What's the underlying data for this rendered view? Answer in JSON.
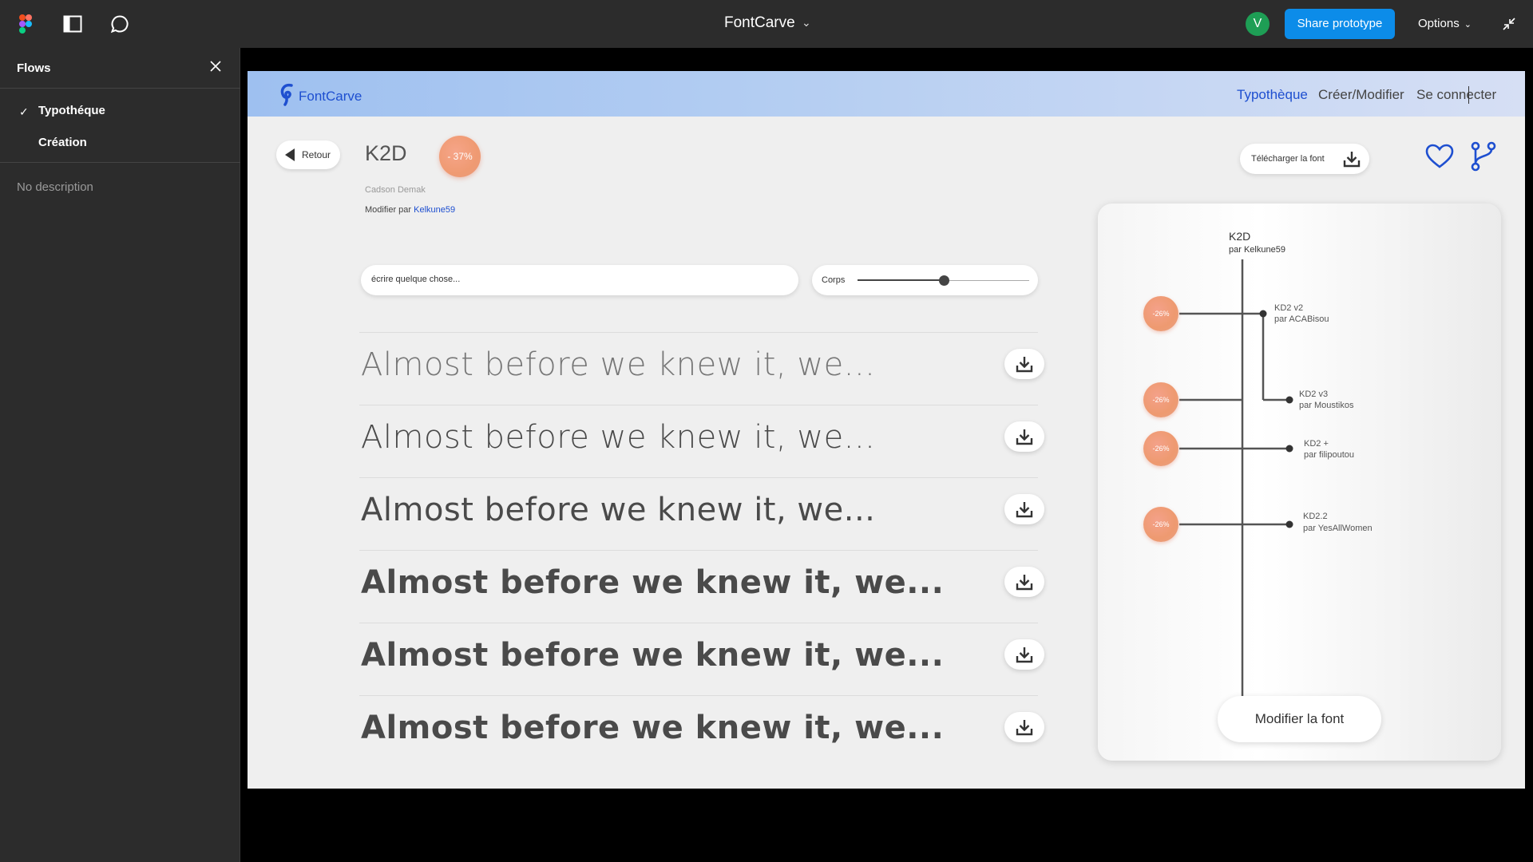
{
  "topbar": {
    "title": "FontCarve",
    "avatar_initial": "V",
    "share_label": "Share prototype",
    "options_label": "Options"
  },
  "sidebar": {
    "heading": "Flows",
    "items": [
      {
        "label": "Typothéque",
        "selected": true
      },
      {
        "label": "Création",
        "selected": false
      }
    ],
    "description": "No description"
  },
  "app": {
    "brand": "FontCarve",
    "nav": [
      {
        "label": "Typothèque",
        "active": true
      },
      {
        "label": "Créer/Modifier",
        "active": false
      },
      {
        "label": "Se connecter",
        "active": false
      }
    ],
    "back_label": "Retour",
    "font_name": "K2D",
    "badge": "- 37%",
    "designer": "Cadson Demak",
    "modified_prefix": "Modifier par",
    "modified_by": "Kelkune59",
    "download_font_label": "Télécharger la font",
    "text_input_value": "écrire quelque chose...",
    "size_label": "Corps",
    "size_level": 0.5,
    "sample_text": "Almost before we knew it, we...",
    "sample_weights": [
      100,
      300,
      400,
      600,
      700,
      800
    ]
  },
  "tree": {
    "root_name": "K2D",
    "root_by": "par Kelkune59",
    "branches": [
      {
        "name": "KD2 v2",
        "by": "par ACABisou",
        "badge": "-26%"
      },
      {
        "name": "KD2 v3",
        "by": "par Moustikos",
        "badge": "-26%"
      },
      {
        "name": "KD2 +",
        "by": "par filipoutou",
        "badge": "-26%"
      },
      {
        "name": "KD2.2",
        "by": "par YesAllWomen",
        "badge": "-26%"
      }
    ],
    "modify_label": "Modifier la font"
  },
  "colors": {
    "accent": "#1e4fd0",
    "figma_blue": "#0c8ce9",
    "badge": "#ef9a72"
  }
}
